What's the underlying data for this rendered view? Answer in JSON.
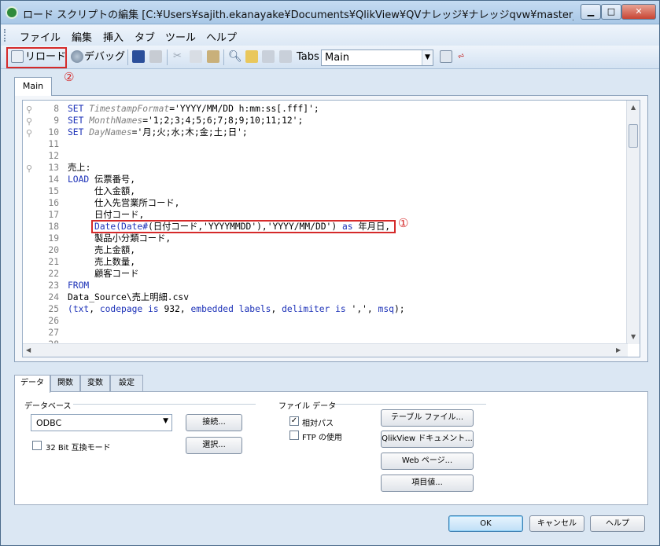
{
  "window": {
    "title": "ロード スクリプトの編集 [C:¥Users¥sajith.ekanayake¥Documents¥QlikView¥QVナレッジ¥ナレッジqvw¥master_caland..."
  },
  "menu": [
    "ファイル",
    "編集",
    "挿入",
    "タブ",
    "ツール",
    "ヘルプ"
  ],
  "toolbar": {
    "reload_label": "リロード",
    "debug_label": "デバッグ",
    "tabs_label": "Tabs",
    "tabs_select_value": "Main"
  },
  "annotations": {
    "marker_reload": "②",
    "marker_code": "①"
  },
  "editor": {
    "tab_label": "Main",
    "lines": [
      {
        "n": "8",
        "bookmark": true,
        "parts": [
          [
            "kw",
            "SET "
          ],
          [
            "vr",
            "TimestampFormat"
          ],
          [
            "",
            "='YYYY/MM/DD h:mm:ss[.fff]';"
          ]
        ]
      },
      {
        "n": "9",
        "bookmark": true,
        "parts": [
          [
            "kw",
            "SET "
          ],
          [
            "vr",
            "MonthNames"
          ],
          [
            "",
            "='1;2;3;4;5;6;7;8;9;10;11;12';"
          ]
        ]
      },
      {
        "n": "10",
        "bookmark": true,
        "parts": [
          [
            "kw",
            "SET "
          ],
          [
            "vr",
            "DayNames"
          ],
          [
            "",
            "='月;火;水;木;金;土;日';"
          ]
        ]
      },
      {
        "n": "11",
        "bookmark": false,
        "parts": []
      },
      {
        "n": "12",
        "bookmark": false,
        "parts": []
      },
      {
        "n": "13",
        "bookmark": true,
        "parts": [
          [
            "",
            "売上:"
          ]
        ]
      },
      {
        "n": "14",
        "bookmark": false,
        "parts": [
          [
            "kw",
            "LOAD "
          ],
          [
            "",
            "伝票番号,"
          ]
        ]
      },
      {
        "n": "15",
        "bookmark": false,
        "parts": [
          [
            "",
            "     仕入金額,"
          ]
        ]
      },
      {
        "n": "16",
        "bookmark": false,
        "parts": [
          [
            "",
            "     仕入先営業所コード,"
          ]
        ]
      },
      {
        "n": "17",
        "bookmark": false,
        "parts": [
          [
            "",
            "     日付コード,"
          ]
        ]
      },
      {
        "n": "18",
        "bookmark": false,
        "parts": [
          [
            "",
            "     "
          ],
          [
            "kw",
            "Date(Date#"
          ],
          [
            "",
            "(日付コード,'YYYYMMDD'),'YYYY/MM/DD') "
          ],
          [
            "kw",
            "as "
          ],
          [
            "",
            "年月日,"
          ]
        ]
      },
      {
        "n": "19",
        "bookmark": false,
        "parts": [
          [
            "",
            "     製品小分類コード,"
          ]
        ]
      },
      {
        "n": "20",
        "bookmark": false,
        "parts": [
          [
            "",
            "     売上金額,"
          ]
        ]
      },
      {
        "n": "21",
        "bookmark": false,
        "parts": [
          [
            "",
            "     売上数量,"
          ]
        ]
      },
      {
        "n": "22",
        "bookmark": false,
        "parts": [
          [
            "",
            "     顧客コード"
          ]
        ]
      },
      {
        "n": "23",
        "bookmark": false,
        "parts": [
          [
            "kw",
            "FROM"
          ]
        ]
      },
      {
        "n": "24",
        "bookmark": false,
        "parts": [
          [
            "",
            "Data_Source\\売上明細.csv"
          ]
        ]
      },
      {
        "n": "25",
        "bookmark": false,
        "parts": [
          [
            "kw",
            "("
          ],
          [
            "kw",
            "txt"
          ],
          [
            "",
            ", "
          ],
          [
            "kw",
            "codepage is "
          ],
          [
            "",
            "932, "
          ],
          [
            "kw",
            "embedded labels"
          ],
          [
            "",
            ", "
          ],
          [
            "kw",
            "delimiter is "
          ],
          [
            "",
            "',', "
          ],
          [
            "kw",
            "msq"
          ],
          [
            "",
            ");"
          ]
        ]
      },
      {
        "n": "26",
        "bookmark": false,
        "parts": []
      },
      {
        "n": "27",
        "bookmark": false,
        "parts": []
      },
      {
        "n": "28",
        "bookmark": false,
        "parts": []
      }
    ]
  },
  "panel": {
    "tabs": [
      "データ",
      "関数",
      "変数",
      "設定"
    ],
    "database_group": "データベース",
    "database_value": "ODBC",
    "connect_button": "接続...",
    "select_button": "選択...",
    "compat_mode_label": "32 Bit 互換モード",
    "file_data_group": "ファイル データ",
    "relative_path_label": "相対パス",
    "ftp_label": "FTP の使用",
    "table_file_button": "テーブル ファイル...",
    "qlikview_doc_button": "QlikView ドキュメント...",
    "web_page_button": "Web ページ...",
    "field_value_button": "項目値..."
  },
  "footer": {
    "ok": "OK",
    "cancel": "キャンセル",
    "help": "ヘルプ"
  }
}
